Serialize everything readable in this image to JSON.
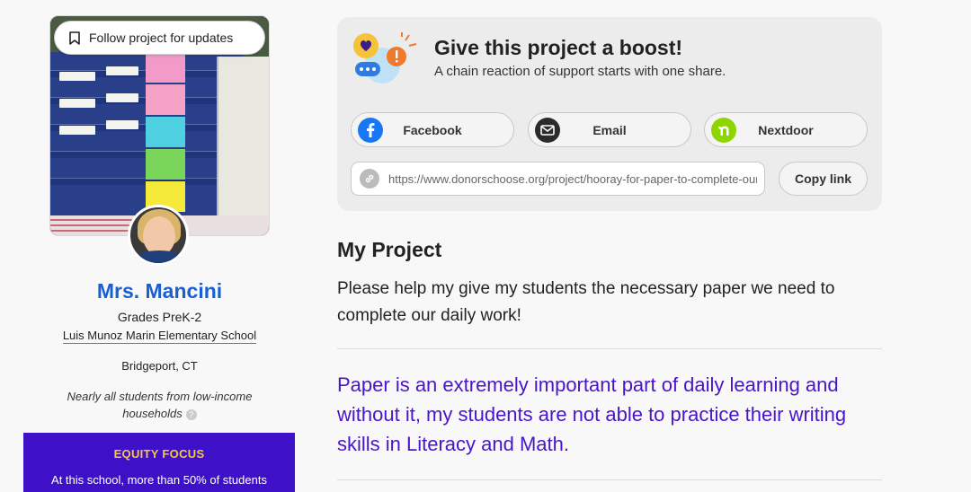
{
  "follow": {
    "label": "Follow project for updates"
  },
  "teacher": {
    "name": "Mrs. Mancini",
    "grades": "Grades PreK-2",
    "school": "Luis Munoz Marin Elementary School",
    "location": "Bridgeport, CT",
    "income_note": "Nearly all students from low-income households",
    "help_glyph": "?"
  },
  "equity": {
    "title": "EQUITY FOCUS",
    "text": "At this school, more than 50% of students"
  },
  "share": {
    "title": "Give this project a boost!",
    "subtitle": "A chain reaction of support starts with one share.",
    "buttons": [
      {
        "label": "Facebook",
        "icon": "facebook-icon"
      },
      {
        "label": "Email",
        "icon": "email-icon"
      },
      {
        "label": "Nextdoor",
        "icon": "nextdoor-icon"
      }
    ],
    "url": "https://www.donorschoose.org/project/hooray-for-paper-to-complete-our-daily-work/",
    "copy_label": "Copy link"
  },
  "project": {
    "heading": "My Project",
    "description": "Please help my give my students the necessary paper we need to complete our daily work!",
    "quote": "Paper is an extremely important part of daily learning and without it, my students are not able to practice their writing skills in Literacy and Math."
  },
  "colors": {
    "brand_blue": "#1a5fd0",
    "equity_purple": "#3e10c8",
    "equity_gold": "#f5c842",
    "quote_purple": "#4a14c8",
    "facebook": "#1877f2",
    "nextdoor": "#8ed500"
  }
}
